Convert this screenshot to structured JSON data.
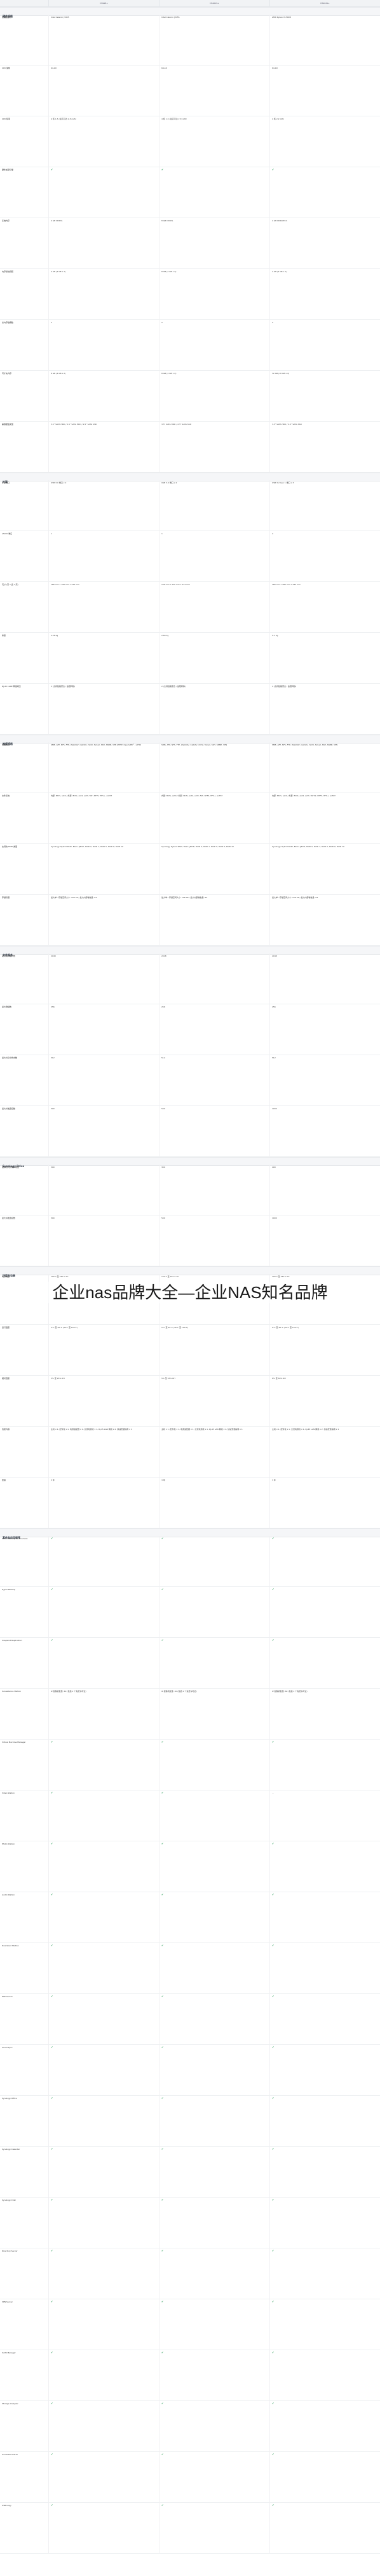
{
  "headline": "企业nas品牌大全—企业NAS知名品牌",
  "columns": [
    "",
    "DS918+",
    "DS1019+",
    "DS1621+"
  ],
  "sections": [
    {
      "title": "硬件规格",
      "rows": [
        [
          "处理器型号",
          "Intel Celeron J3455",
          "Intel Celeron J3455",
          "AMD Ryzen V1500B"
        ],
        [
          "CPU 架构",
          "64-bit",
          "64-bit",
          "64-bit"
        ],
        [
          "CPU 频率",
          "4 核 1.5 (最高可达 2.3) GHz",
          "4 核 1.5 (最高可达 2.3) GHz",
          "4 核 2.2 GHz"
        ],
        [
          "硬件加密引擎",
          "✔",
          "✔",
          "✔"
        ],
        [
          "系统内存",
          "4 GB DDR3L",
          "8 GB DDR3L",
          "4 GB DDR4 ECC"
        ],
        [
          "内存模块预装",
          "4 GB (4 GB x 1)",
          "8 GB (4 GB x 2)",
          "4 GB (4 GB x 1)"
        ],
        [
          "总内存插槽数",
          "2",
          "2",
          "2"
        ],
        [
          "可扩充内存",
          "8 GB (4 GB x 2)",
          "8 GB (4 GB x 2)",
          "32 GB (16 GB x 2)"
        ],
        [
          "兼容硬盘类型",
          "3.5\" SATA HDD / 2.5\" SATA HDD / 2.5\" SATA SSD",
          "3.5\" SATA HDD / 2.5\" SATA SSD",
          "3.5\" SATA HDD / 2.5\" SATA SSD"
        ]
      ]
    },
    {
      "title": "外观",
      "rows": [
        [
          "外部端口",
          "USB 3.0 端口 x 2",
          "USB 3.0 端口 x 2",
          "USB 3.2 Gen 1 端口 x 3"
        ],
        [
          "eSATA 端口",
          "1",
          "1",
          "2"
        ],
        [
          "尺寸 (高 x 宽 x 深)",
          "166 mm x 199 mm x 223 mm",
          "166 mm x 230 mm x 223 mm",
          "166 mm x 282 mm x 243 mm"
        ],
        [
          "重量",
          "2.28 kg",
          "2.64 kg",
          "5.1 kg"
        ],
        [
          "RJ-45 1GbE 网络端口",
          "2 (支持链路聚合 / 故障转移)",
          "2 (支持链路聚合 / 故障转移)",
          "4 (支持链路聚合 / 故障转移)"
        ]
      ]
    },
    {
      "title": "常规规格",
      "rows": [
        [
          "网络协议",
          "SMB, AFP, NFS, FTP, WebDAV, CalDAV, iSCSI, Telnet, SSH, SNMP, VPN (PPTP, OpenVPN™, L2TP)",
          "SMB, AFP, NFS, FTP, WebDAV, CalDAV, iSCSI, Telnet, SSH, SNMP, VPN",
          "SMB, AFP, NFS, FTP, WebDAV, CalDAV, iSCSI, Telnet, SSH, SNMP, VPN"
        ],
        [
          "文件系统",
          "内部: Btrfs, ext4 / 外部: Btrfs, ext4, ext3, FAT, NTFS, HFS+, exFAT",
          "内部: Btrfs, ext4 / 外部: Btrfs, ext4, ext3, FAT, NTFS, HFS+, exFAT",
          "内部: Btrfs, ext4 / 外部: Btrfs, ext4, ext3, FAT32, NTFS, HFS+, exFAT"
        ],
        [
          "支持的 RAID 类型",
          "Synology Hybrid RAID, Basic, JBOD, RAID 0, RAID 1, RAID 5, RAID 6, RAID 10",
          "Synology Hybrid RAID, Basic, JBOD, RAID 0, RAID 1, RAID 5, RAID 6, RAID 10",
          "Synology Hybrid RAID, Basic, JBOD, RAID 0, RAID 1, RAID 5, RAID 6, RAID 10"
        ],
        [
          "存储管理",
          "最大单一存储空间大小: 108 TB / 最大内部卷数量: 64",
          "最大单一存储空间大小: 108 TB / 最大内部卷数量: 64",
          "最大单一存储空间大小: 108 TB / 最大内部卷数量: 64"
        ]
      ]
    },
    {
      "title": "文件服务",
      "rows": [
        [
          "最大用户帐户数",
          "2048",
          "2048",
          "2048"
        ],
        [
          "最大群组数",
          "256",
          "256",
          "256"
        ],
        [
          "最大共享文件夹数",
          "512",
          "512",
          "512"
        ],
        [
          "最大并发连接数",
          "500",
          "500",
          "1000"
        ]
      ]
    },
    {
      "title": "Synology Drive",
      "rows": [
        [
          "推荐的同步客户端数",
          "300",
          "300",
          "400"
        ],
        [
          "最大并发连接数",
          "500",
          "500",
          "1000"
        ]
      ]
    },
    {
      "title": "环境和包装",
      "rows": [
        [
          "电源电压",
          "100 V 至 240 V AC",
          "100 V 至 240 V AC",
          "100 V 至 240 V AC"
        ],
        [
          "运行温度",
          "5°C 至 40°C (40°F 至 104°F)",
          "5°C 至 40°C (40°F 至 104°F)",
          "0°C 至 40°C (32°F 至 104°F)"
        ],
        [
          "相对湿度",
          "5% 至 95% RH",
          "5% 至 95% RH",
          "8% 至 80% RH"
        ],
        [
          "包装内容",
          "主机 x 1, 配件包 x 1, 电源适配器 x 1, 交流电源线 x 1, RJ-45 LAN 网线 x 2, 快速安装指南 x 1",
          "主机 x 1, 配件包 x 1, 电源适配器 x 1, 交流电源线 x 1, RJ-45 LAN 网线 x 2, 快速安装指南 x 1",
          "主机 x 1, 配件包 x 1, 交流电源线 x 1, RJ-45 LAN 网线 x 2, 快速安装指南 x 1"
        ],
        [
          "质保",
          "3 年",
          "3 年",
          "3 年"
        ]
      ]
    },
    {
      "title": "套件和应用程序",
      "rows": [
        [
          "Active Backup for Business",
          "✔",
          "✔",
          "✔"
        ],
        [
          "Hyper Backup",
          "✔",
          "✔",
          "✔"
        ],
        [
          "Snapshot Replication",
          "✔",
          "✔",
          "✔"
        ],
        [
          "Surveillance Station",
          "IP 摄像机数量: 40 (包括 2 个免费许可证)",
          "IP 摄像机数量: 40 (包括 2 个免费许可证)",
          "IP 摄像机数量: 60 (包括 2 个免费许可证)"
        ],
        [
          "Virtual Machine Manager",
          "✔",
          "✔",
          "✔"
        ],
        [
          "Video Station",
          "✔",
          "✔",
          "—"
        ],
        [
          "Photo Station",
          "✔",
          "✔",
          "✔"
        ],
        [
          "Audio Station",
          "✔",
          "✔",
          "✔"
        ],
        [
          "Download Station",
          "✔",
          "✔",
          "✔"
        ],
        [
          "Mail Server",
          "✔",
          "✔",
          "✔"
        ],
        [
          "Cloud Sync",
          "✔",
          "✔",
          "✔"
        ],
        [
          "Synology Office",
          "✔",
          "✔",
          "✔"
        ],
        [
          "Synology Calendar",
          "✔",
          "✔",
          "✔"
        ],
        [
          "Synology Chat",
          "✔",
          "✔",
          "✔"
        ],
        [
          "Directory Server",
          "✔",
          "✔",
          "✔"
        ],
        [
          "VPN Server",
          "✔",
          "✔",
          "✔"
        ],
        [
          "iSCSI Manager",
          "✔",
          "✔",
          "✔"
        ],
        [
          "Storage Analyzer",
          "✔",
          "✔",
          "✔"
        ],
        [
          "Universal Search",
          "✔",
          "✔",
          "✔"
        ],
        [
          "USB Copy",
          "✔",
          "✔",
          "✔"
        ]
      ]
    }
  ]
}
